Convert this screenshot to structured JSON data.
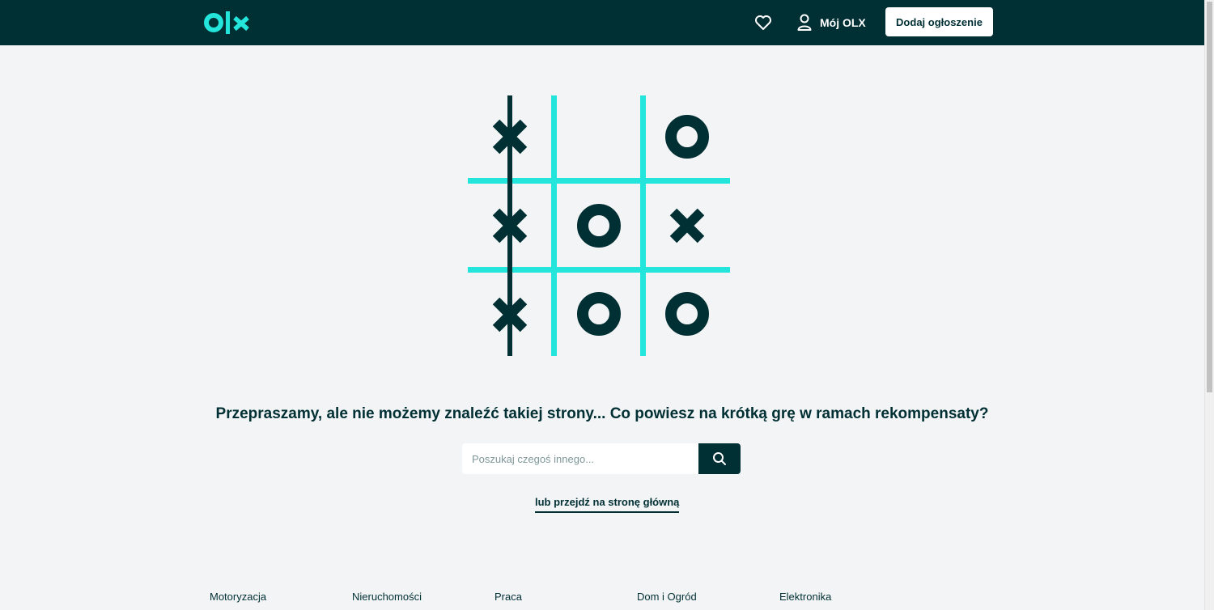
{
  "header": {
    "logo_text": "OLX",
    "favorites_icon": "heart-icon",
    "account_icon": "user-icon",
    "account_label": "Mój OLX",
    "post_ad_label": "Dodaj ogłoszenie"
  },
  "colors": {
    "header_bg": "#002f34",
    "accent": "#23e5db",
    "page_bg": "#f2f4f5"
  },
  "game": {
    "board": [
      [
        "X",
        "",
        "O"
      ],
      [
        "X",
        "O",
        "X"
      ],
      [
        "X",
        "O",
        "O"
      ]
    ],
    "winning_line": "left-column"
  },
  "main": {
    "headline": "Przepraszamy, ale nie możemy znaleźć takiej strony... Co powiesz na krótką grę w ramach rekompensaty?",
    "search_placeholder": "Poszukaj czegoś innego...",
    "search_icon": "search-icon",
    "home_link": "lub przejdź na stronę główną"
  },
  "footer": {
    "categories": [
      "Motoryzacja",
      "Nieruchomości",
      "Praca",
      "Dom i Ogród",
      "Elektronika"
    ]
  }
}
